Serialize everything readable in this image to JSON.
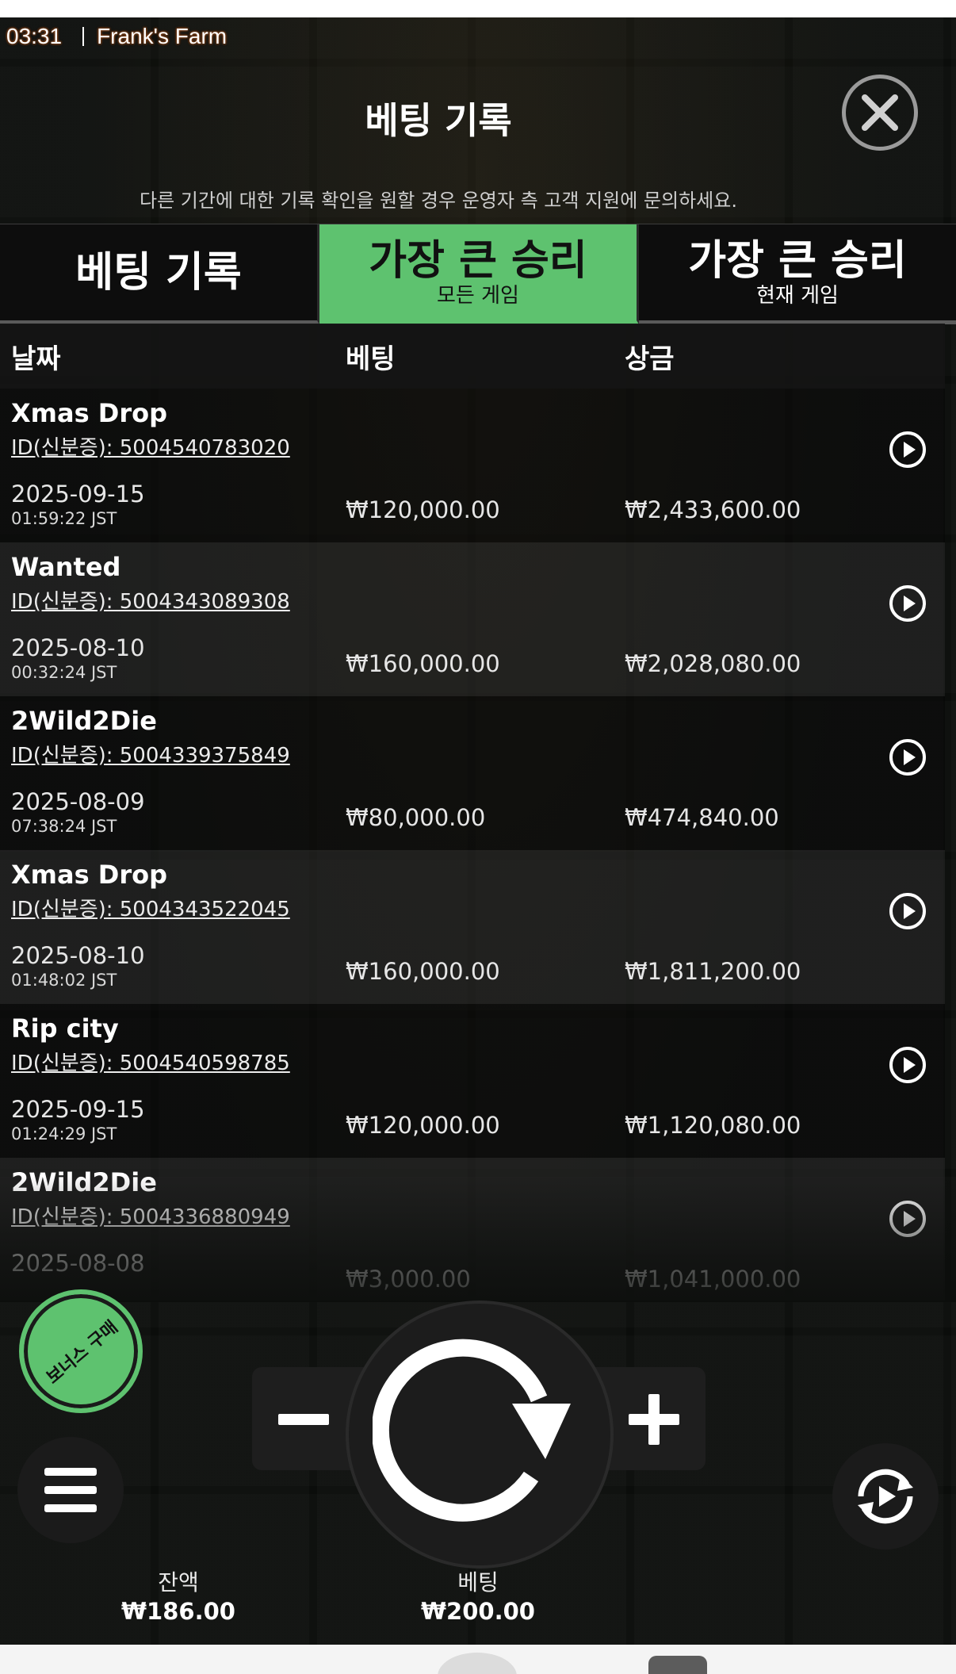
{
  "status": {
    "time": "03:31",
    "game_title": "Frank's Farm"
  },
  "modal": {
    "title": "베팅 기록",
    "subtitle": "다른 기간에 대한 기록 확인을 원할 경우 운영자 측 고객 지원에 문의하세요."
  },
  "tabs": [
    {
      "main": "베팅 기록",
      "sub": "",
      "active": false
    },
    {
      "main": "가장 큰 승리",
      "sub": "모든 게임",
      "active": true
    },
    {
      "main": "가장 큰 승리",
      "sub": "현재 게임",
      "active": false
    }
  ],
  "table": {
    "headers": {
      "date": "날짜",
      "bet": "베팅",
      "win": "상금"
    },
    "rows": [
      {
        "game": "Xmas Drop",
        "id": "ID(신분증): 5004540783020",
        "date": "2025-09-15",
        "time": "01:59:22 JST",
        "bet": "₩120,000.00",
        "win": "₩2,433,600.00"
      },
      {
        "game": "Wanted",
        "id": "ID(신분증): 5004343089308",
        "date": "2025-08-10",
        "time": "00:32:24 JST",
        "bet": "₩160,000.00",
        "win": "₩2,028,080.00"
      },
      {
        "game": "2Wild2Die",
        "id": "ID(신분증): 5004339375849",
        "date": "2025-08-09",
        "time": "07:38:24 JST",
        "bet": "₩80,000.00",
        "win": "₩474,840.00"
      },
      {
        "game": "Xmas Drop",
        "id": "ID(신분증): 5004343522045",
        "date": "2025-08-10",
        "time": "01:48:02 JST",
        "bet": "₩160,000.00",
        "win": "₩1,811,200.00"
      },
      {
        "game": "Rip city",
        "id": "ID(신분증): 5004540598785",
        "date": "2025-09-15",
        "time": "01:24:29 JST",
        "bet": "₩120,000.00",
        "win": "₩1,120,080.00"
      },
      {
        "game": "2Wild2Die",
        "id": "ID(신분증): 5004336880949",
        "date": "2025-08-08",
        "time": "",
        "bet": "₩3,000.00",
        "win": "₩1,041,000.00"
      }
    ]
  },
  "controls": {
    "bonus_buy": "보너스 구매",
    "balance_label": "잔액",
    "balance_value": "₩186.00",
    "bet_label": "베팅",
    "bet_value": "₩200.00"
  },
  "icons": {
    "close": "close-icon",
    "play": "play-icon",
    "menu": "menu-icon",
    "spin": "spin-icon",
    "minus": "minus-icon",
    "plus": "plus-icon",
    "autoplay": "autoplay-icon"
  },
  "colors": {
    "accent": "#5ec26f",
    "background": "#0b0d0b"
  }
}
